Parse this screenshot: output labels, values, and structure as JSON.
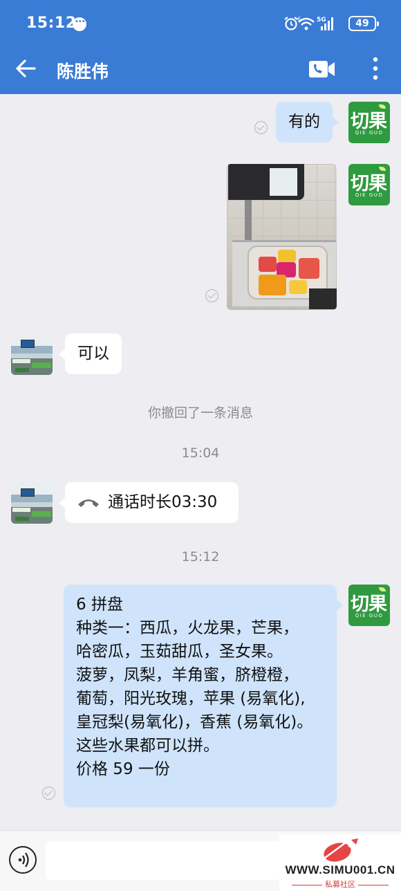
{
  "status_bar": {
    "time": "15:12",
    "network": "5G",
    "wifi_badge": "6",
    "battery": "49"
  },
  "header": {
    "title": "陈胜伟",
    "back_icon": "arrow-left-icon",
    "video_icon": "video-call-icon",
    "more_icon": "more-vertical-icon"
  },
  "avatars": {
    "me_logo_text": "切果",
    "me_logo_sub": "QIE GUO"
  },
  "messages": [
    {
      "sender": "me",
      "type": "text",
      "text": "有的",
      "status": "read"
    },
    {
      "sender": "me",
      "type": "image",
      "status": "read"
    },
    {
      "sender": "other",
      "type": "text",
      "text": "可以"
    },
    {
      "type": "system",
      "text": "你撤回了一条消息"
    },
    {
      "type": "timestamp",
      "text": "15:04"
    },
    {
      "sender": "other",
      "type": "call",
      "text": "通话时长03:30"
    },
    {
      "type": "timestamp",
      "text": "15:12"
    },
    {
      "sender": "me",
      "type": "text",
      "status": "read",
      "lines": [
        "6 拼盘",
        "种类一：西瓜，火龙果，芒果，",
        "哈密瓜，玉茹甜瓜，圣女果。",
        "菠萝，凤梨，羊角蜜，脐橙橙，",
        "葡萄，阳光玫瑰，苹果 (易氧化),",
        "皇冠梨(易氧化)，香蕉 (易氧化)。",
        "这些水果都可以拼。",
        "价格 59 一份"
      ]
    }
  ],
  "input": {
    "placeholder": ""
  },
  "watermark": {
    "url": "WWW.SIMU001.CN",
    "sub": "私募社区"
  },
  "colors": {
    "header": "#3a7bd5",
    "my_bubble": "#cfe4fb",
    "background": "#ededf2"
  }
}
